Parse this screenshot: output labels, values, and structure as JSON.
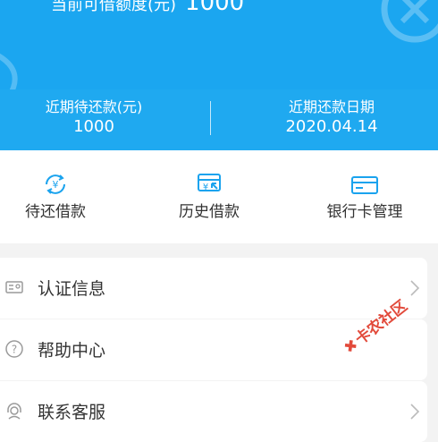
{
  "banner": {
    "credit_label": "当前可借额度(元)",
    "credit_value": "1000",
    "due_amount_label": "近期待还款(元)",
    "due_amount_value": "1000",
    "due_date_label": "近期还款日期",
    "due_date_value": "2020.04.14",
    "color": "#1ba6f0"
  },
  "quick_actions": [
    {
      "label": "待还借款",
      "icon": "yen-refresh-icon"
    },
    {
      "label": "历史借款",
      "icon": "receipt-history-icon"
    },
    {
      "label": "银行卡管理",
      "icon": "bank-card-icon"
    }
  ],
  "menu": [
    {
      "label": "认证信息",
      "icon": "id-card-icon"
    },
    {
      "label": "帮助中心",
      "icon": "help-icon"
    },
    {
      "label": "联系客服",
      "icon": "customer-service-icon"
    }
  ],
  "watermark": {
    "text": "卡农社区",
    "color": "#e24a3b"
  },
  "accent_color": "#1aa3ee"
}
